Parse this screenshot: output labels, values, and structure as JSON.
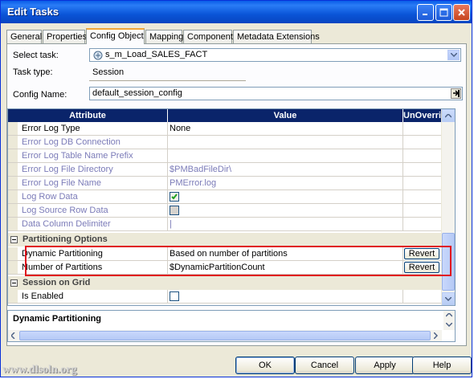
{
  "window": {
    "title": "Edit Tasks"
  },
  "tabs": [
    "General",
    "Properties",
    "Config Object",
    "Mapping",
    "Components",
    "Metadata Extensions"
  ],
  "active_tab": "Config Object",
  "form": {
    "select_task_label": "Select task:",
    "select_task_value": "s_m_Load_SALES_FACT",
    "task_type_label": "Task type:",
    "task_type_value": "Session",
    "config_name_label": "Config Name:",
    "config_name_value": "default_session_config"
  },
  "grid": {
    "headers": {
      "attribute": "Attribute",
      "value": "Value",
      "unoverride": "UnOverri..."
    },
    "rows": [
      {
        "attribute": "Error Log Type",
        "value": "None"
      },
      {
        "attribute": "Error Log DB Connection",
        "value": ""
      },
      {
        "attribute": "Error Log Table Name Prefix",
        "value": ""
      },
      {
        "attribute": "Error Log File Directory",
        "value": "$PMBadFileDir\\"
      },
      {
        "attribute": "Error Log File Name",
        "value": "PMError.log"
      },
      {
        "attribute": "Log Row Data",
        "value": ""
      },
      {
        "attribute": "Log Source Row Data",
        "value": ""
      },
      {
        "attribute": "Data Column Delimiter",
        "value": "|"
      }
    ],
    "group_partitioning": "Partitioning Options",
    "partition_rows": [
      {
        "attribute": "Dynamic Partitioning",
        "value": "Based on number of partitions",
        "revert": "Revert"
      },
      {
        "attribute": "Number of Partitions",
        "value": "$DynamicPartitionCount",
        "revert": "Revert"
      }
    ],
    "group_grid": "Session on Grid",
    "grid_rows": [
      {
        "attribute": "Is Enabled",
        "value": ""
      }
    ]
  },
  "description": {
    "title": "Dynamic Partitioning"
  },
  "buttons": {
    "ok": "OK",
    "cancel": "Cancel",
    "apply": "Apply",
    "help": "Help"
  },
  "watermark": "www.dlsoln.org"
}
